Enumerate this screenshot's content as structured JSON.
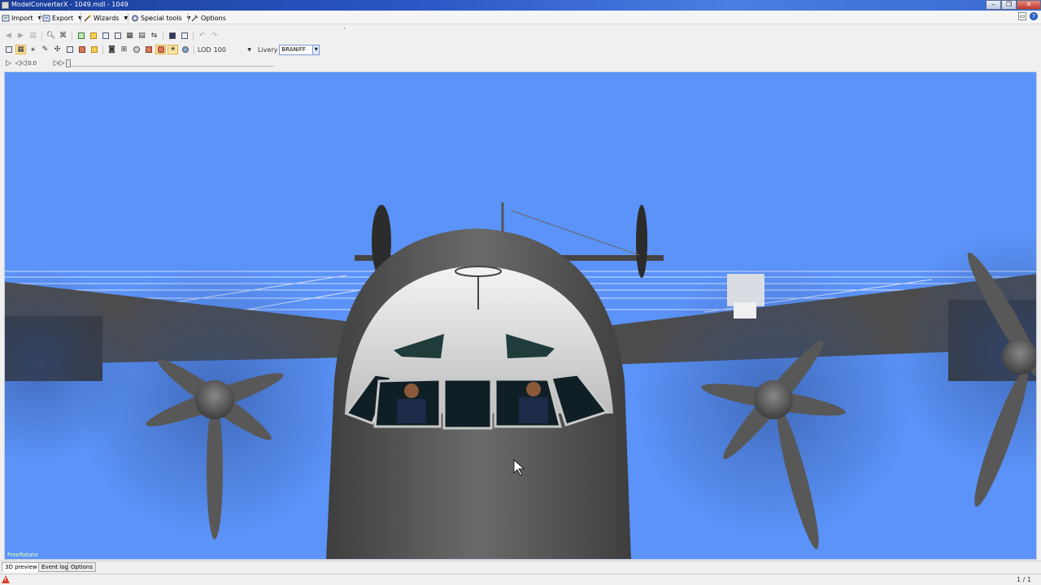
{
  "window": {
    "title": "ModelConverterX - 1049.mdl - 1049",
    "controls": [
      "minimize",
      "restore",
      "close"
    ]
  },
  "menu": {
    "items": [
      {
        "label": "Import",
        "icon": "import-icon"
      },
      {
        "label": "Export",
        "icon": "export-icon"
      },
      {
        "label": "Wizards",
        "icon": "wand-icon"
      },
      {
        "label": "Special tools",
        "icon": "gear-icon"
      },
      {
        "label": "Options",
        "icon": "wrench-icon"
      }
    ]
  },
  "toolbar": {
    "lod_label": "LOD",
    "lod_value": "100",
    "livery_label": "Livery",
    "livery_value": "BRANIFF",
    "anim_value": "0.0",
    "anim_progress": 0
  },
  "viewport": {
    "mode_label": "FreeRotate",
    "sky_color": "#5b93f8",
    "aircraft_color": "#5a5a5a"
  },
  "tabs": [
    {
      "label": "3D preview",
      "active": true
    },
    {
      "label": "Event log",
      "active": false
    },
    {
      "label": "Options",
      "active": false
    }
  ],
  "status": {
    "page": "1 / 1",
    "warning_icon": "warning-icon"
  }
}
